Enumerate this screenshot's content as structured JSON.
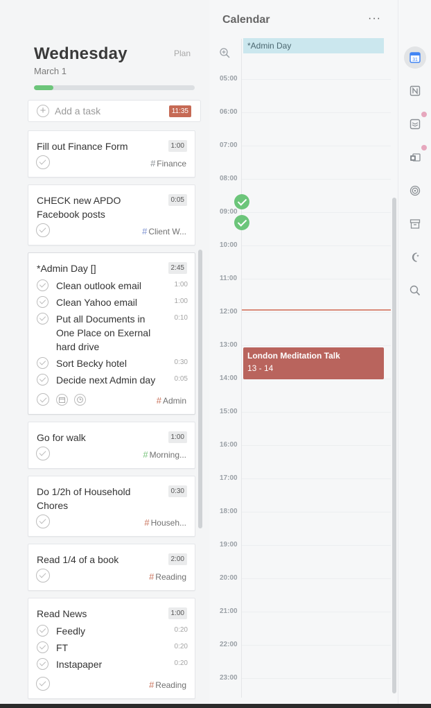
{
  "day": {
    "weekday": "Wednesday",
    "date": "March 1",
    "plan_label": "Plan",
    "progress": 0.12
  },
  "add_task": {
    "placeholder": "Add a task",
    "total": "11:35"
  },
  "tasks": [
    {
      "title": "Fill out Finance Form",
      "duration": "1:00",
      "tag": "Finance",
      "tag_color": "#8a8f94"
    },
    {
      "title": "CHECK new APDO Facebook posts",
      "duration": "0:05",
      "tag": "Client W...",
      "tag_color": "#7a8fd0"
    },
    {
      "title": "*Admin Day []",
      "duration": "2:45",
      "tag": "Admin",
      "tag_color": "#c9735c",
      "subtasks": [
        {
          "text": "Clean outlook email",
          "duration": "1:00"
        },
        {
          "text": "Clean Yahoo email",
          "duration": "1:00"
        },
        {
          "text": "Put all Documents in One Place on Exernal hard drive",
          "duration": "0:10"
        },
        {
          "text": "Sort Becky hotel",
          "duration": "0:30"
        },
        {
          "text": "Decide next Admin day",
          "duration": "0:05"
        }
      ]
    },
    {
      "title": "Go for walk",
      "duration": "1:00",
      "tag": "Morning...",
      "tag_color": "#7bc47f"
    },
    {
      "title": "Do 1/2h of Household Chores",
      "duration": "0:30",
      "tag": "Househ...",
      "tag_color": "#c9735c"
    },
    {
      "title": "Read 1/4 of a book",
      "duration": "2:00",
      "tag": "Reading",
      "tag_color": "#c9735c"
    },
    {
      "title": "Read News",
      "duration": "1:00",
      "tag": "Reading",
      "tag_color": "#c9735c",
      "subtasks": [
        {
          "text": "Feedly",
          "duration": "0:20"
        },
        {
          "text": "FT",
          "duration": "0:20"
        },
        {
          "text": "Instapaper",
          "duration": "0:20"
        }
      ]
    }
  ],
  "calendar": {
    "title": "Calendar",
    "more_label": "···",
    "hours": [
      "05:00",
      "06:00",
      "07:00",
      "08:00",
      "09:00",
      "10:00",
      "11:00",
      "12:00",
      "13:00",
      "14:00",
      "15:00",
      "16:00",
      "17:00",
      "18:00",
      "19:00",
      "20:00",
      "21:00",
      "22:00",
      "23:00"
    ],
    "all_day_event": "*Admin Day",
    "event": {
      "title": "London Meditation Talk",
      "time": "13 - 14",
      "color": "#b9645d"
    }
  },
  "rail": {
    "icons": [
      "google-calendar-icon",
      "notion-icon",
      "todoist-icon",
      "outlook-icon",
      "target-icon",
      "archive-icon",
      "night-mode-icon",
      "search-icon"
    ]
  }
}
